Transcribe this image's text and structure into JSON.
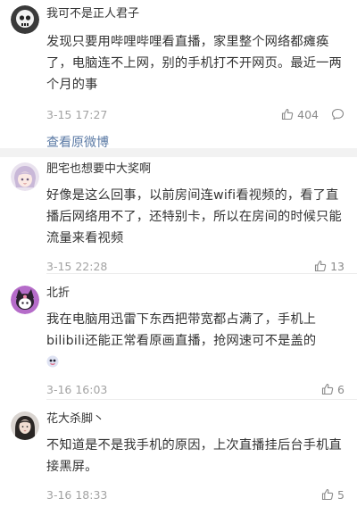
{
  "comments": [
    {
      "username": "我可不是正人君子",
      "text": "发现只要用哔哩哔哩看直播，家里整个网络都瘫痪了，电脑连不上网，别的手机打不开网页。最近一两个月的事",
      "time": "3-15 17:27",
      "likes": "404",
      "link": "查看原微博",
      "avatar": "avatar-skull-icon"
    },
    {
      "username": "肥宅也想要中大奖啊",
      "text": "好像是这么回事，以前房间连wifi看视频的，看了直播后网络用不了，还特别卡，所以在房间的时候只能流量来看视频",
      "time": "3-15 22:28",
      "likes": "13",
      "avatar": "avatar-anime-girl-icon"
    },
    {
      "username": "北折",
      "text": "我在电脑用迅雷下东西把带宽都占满了，手机上bilibili还能正常看原画直播，抢网速可不是盖的",
      "time": "3-16 16:03",
      "likes": "6",
      "avatar": "avatar-kuromi-icon"
    },
    {
      "username": "花大杀脚丶",
      "text": "不知道是不是我手机的原因，上次直播挂后台手机直接黑屏。",
      "time": "3-16 18:33",
      "likes": "5",
      "avatar": "avatar-portrait-icon"
    }
  ],
  "colors": {
    "link": "#5b7aa5",
    "muted": "#a3a3a3",
    "divider": "#f2f2f2"
  }
}
